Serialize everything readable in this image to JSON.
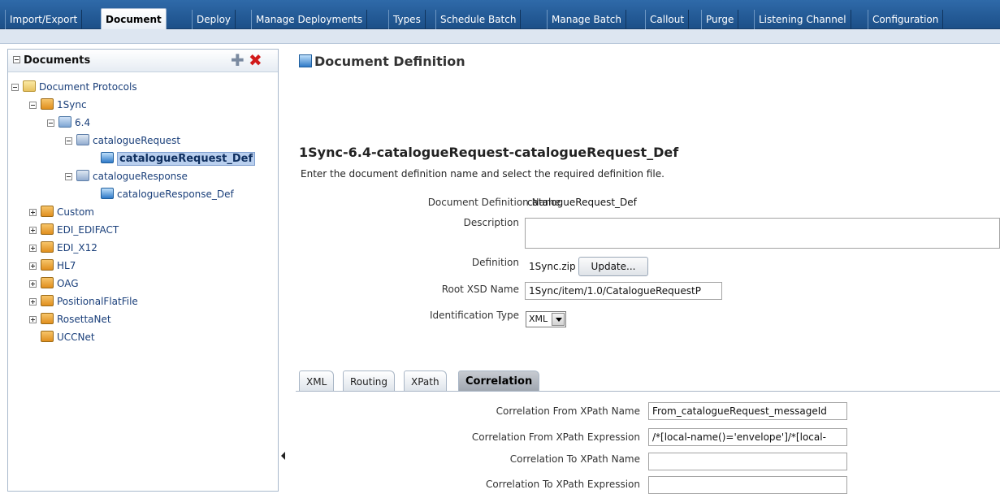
{
  "top_tabs": [
    {
      "label": "Import/Export",
      "active": false
    },
    {
      "label": "Document",
      "active": true
    },
    {
      "label": "Deploy",
      "active": false
    },
    {
      "label": "Manage Deployments",
      "active": false
    },
    {
      "label": "Types",
      "active": false
    },
    {
      "label": "Schedule Batch",
      "active": false
    },
    {
      "label": "Manage Batch",
      "active": false
    },
    {
      "label": "Callout",
      "active": false
    },
    {
      "label": "Purge",
      "active": false
    },
    {
      "label": "Listening Channel",
      "active": false
    },
    {
      "label": "Configuration",
      "active": false
    }
  ],
  "left_panel": {
    "title": "Documents",
    "add_icon": "add-icon",
    "delete_icon": "delete-icon",
    "tree": [
      {
        "label": "Document Protocols",
        "icon": "folder-icon",
        "expander": "minus"
      },
      {
        "label": "1Sync",
        "icon": "protocol-icon",
        "expander": "minus"
      },
      {
        "label": "6.4",
        "icon": "version-icon",
        "expander": "minus"
      },
      {
        "label": "catalogueRequest",
        "icon": "document-type-icon",
        "expander": "minus"
      },
      {
        "label": "catalogueRequest_Def",
        "icon": "document-definition-icon",
        "expander": "",
        "selected": true
      },
      {
        "label": "catalogueResponse",
        "icon": "document-type-icon",
        "expander": "minus"
      },
      {
        "label": "catalogueResponse_Def",
        "icon": "document-definition-icon",
        "expander": ""
      },
      {
        "label": "Custom",
        "icon": "protocol-icon",
        "expander": "plus"
      },
      {
        "label": "EDI_EDIFACT",
        "icon": "protocol-icon",
        "expander": "plus"
      },
      {
        "label": "EDI_X12",
        "icon": "protocol-icon",
        "expander": "plus"
      },
      {
        "label": "HL7",
        "icon": "protocol-icon",
        "expander": "plus"
      },
      {
        "label": "OAG",
        "icon": "protocol-icon",
        "expander": "plus"
      },
      {
        "label": "PositionalFlatFile",
        "icon": "protocol-icon",
        "expander": "plus"
      },
      {
        "label": "RosettaNet",
        "icon": "protocol-icon",
        "expander": "plus"
      },
      {
        "label": "UCCNet",
        "icon": "protocol-icon",
        "expander": ""
      }
    ]
  },
  "main": {
    "title": "Document Definition",
    "heading": "1Sync-6.4-catalogueRequest-catalogueRequest_Def",
    "description": "Enter the document definition name and select the required definition file.",
    "fields": {
      "name_label": "Document Definition Name",
      "name_value": "catalogueRequest_Def",
      "description_label": "Description",
      "description_value": "",
      "definition_label": "Definition",
      "definition_value": "1Sync.zip",
      "update_button": "Update...",
      "root_xsd_label": "Root XSD Name",
      "root_xsd_value": "1Sync/item/1.0/CatalogueRequestP",
      "identification_label": "Identification Type",
      "identification_value": "XML"
    },
    "subtabs": [
      {
        "label": "XML",
        "active": false
      },
      {
        "label": "Routing",
        "active": false
      },
      {
        "label": "XPath",
        "active": false
      },
      {
        "label": "Correlation",
        "active": true
      }
    ],
    "correlation": {
      "from_name_label": "Correlation From XPath Name",
      "from_name_value": "From_catalogueRequest_messageId",
      "from_expr_label": "Correlation From XPath Expression",
      "from_expr_value": "/*[local-name()='envelope']/*[local-",
      "to_name_label": "Correlation To XPath Name",
      "to_name_value": "",
      "to_expr_label": "Correlation To XPath Expression",
      "to_expr_value": ""
    }
  },
  "colors": {
    "topbar": "#1c4f88",
    "selection": "#b9cfee",
    "delete": "#d11a1a"
  }
}
